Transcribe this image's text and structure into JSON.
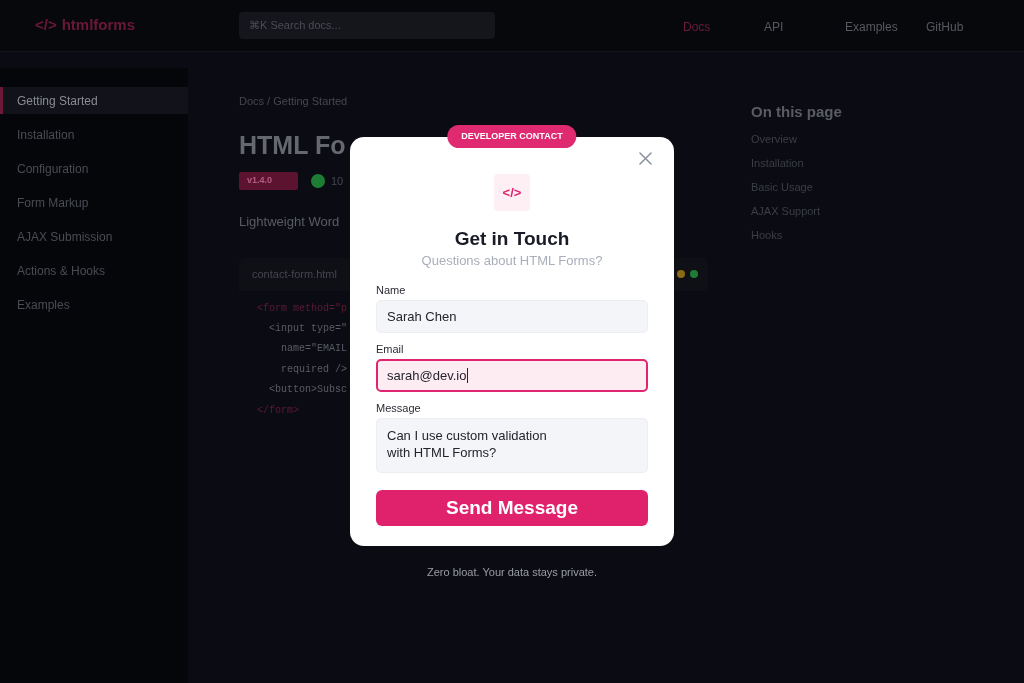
{
  "header": {
    "logo": {
      "mark": "</>",
      "name": "htmlforms"
    },
    "search": {
      "placeholder": "⌘K Search docs..."
    },
    "nav": [
      {
        "label": "Docs",
        "selected": true
      },
      {
        "label": "API",
        "selected": false
      },
      {
        "label": "Examples",
        "selected": false
      },
      {
        "label": "GitHub",
        "selected": false
      }
    ]
  },
  "sidebar": {
    "items": [
      {
        "label": "Getting Started",
        "selected": true
      },
      {
        "label": "Installation",
        "selected": false
      },
      {
        "label": "Configuration",
        "selected": false
      },
      {
        "label": "Form Markup",
        "selected": false
      },
      {
        "label": "AJAX Submission",
        "selected": false
      },
      {
        "label": "Actions & Hooks",
        "selected": false
      },
      {
        "label": "Examples",
        "selected": false
      }
    ]
  },
  "content": {
    "breadcrumb": "Docs / Getting Started",
    "title": "HTML Fo",
    "version_badge": "v1.4.0",
    "status": {
      "color": "#1e7d35",
      "text": "10"
    },
    "description": "Lightweight Word",
    "code_block": {
      "filename": "contact-form.html",
      "window_dots": [
        {
          "color": "#8a6a12"
        },
        {
          "color": "#1e7d35"
        }
      ],
      "lines": [
        {
          "kind": "tag",
          "text": "<form method=\"p"
        },
        {
          "kind": "code",
          "text": "  <input type=\""
        },
        {
          "kind": "code",
          "text": "    name=\"EMAIL"
        },
        {
          "kind": "code",
          "text": "    required />"
        },
        {
          "kind": "code",
          "text": "  <button>Subsc"
        },
        {
          "kind": "tag",
          "text": "</form>"
        }
      ]
    }
  },
  "toc": {
    "title": "On this page",
    "items": [
      "Overview",
      "Installation",
      "Basic Usage",
      "AJAX Support",
      "Hooks"
    ]
  },
  "modal": {
    "badge": "DEVELOPER CONTACT",
    "icon_text": "</>",
    "title": "Get in Touch",
    "subtitle": "Questions about HTML Forms?",
    "fields": [
      {
        "kind": "input",
        "label": "Name",
        "value": "Sarah Chen",
        "focused": false
      },
      {
        "kind": "input",
        "label": "Email",
        "value": "sarah@dev.io",
        "focused": true
      },
      {
        "kind": "textarea",
        "label": "Message",
        "value": "Can I use custom validation\nwith HTML Forms?",
        "focused": false
      }
    ],
    "submit": "Send Message",
    "footnote": "Zero bloat. Your data stays private."
  }
}
